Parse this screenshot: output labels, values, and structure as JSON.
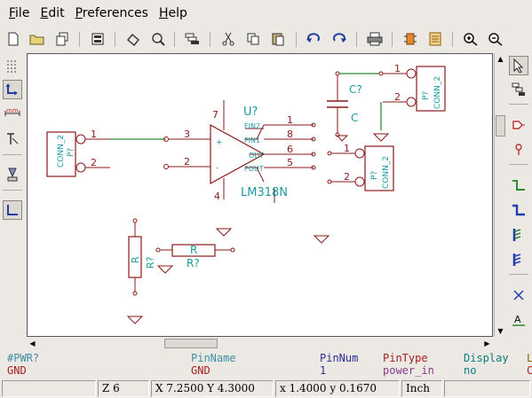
{
  "menu": {
    "file": {
      "mn": "F",
      "rest": "ile"
    },
    "edit": {
      "mn": "E",
      "rest": "dit"
    },
    "preferences": {
      "mn": "P",
      "rest": "references"
    },
    "help": {
      "mn": "H",
      "rest": "elp"
    }
  },
  "toolbar_icons": [
    "new-sheet-icon",
    "open-icon",
    "save-icon",
    "sheet-settings-icon",
    "undo-icon",
    "redo-icon",
    "component-list-icon",
    "cut-icon",
    "copy-icon",
    "paste-icon",
    "rotate-ccw-icon",
    "rotate-cw-icon",
    "print-icon",
    "annotate-icon",
    "bom-icon",
    "zoom-in-icon",
    "zoom-out-icon"
  ],
  "schematic": {
    "conn_left": {
      "ref": "P?",
      "value": "CONN_2",
      "pin1": "1",
      "pin2": "2"
    },
    "opamp": {
      "ref": "U?",
      "value": "LM318N",
      "pin_in_plus": "3",
      "pin_in_minus": "2",
      "pin_top": "7",
      "pin_bottom": "4",
      "plus_sign": "+",
      "minus_sign": "-",
      "fin2": "FIN2",
      "fin1": "FIN1",
      "out": "OUT",
      "fout": "FOUT",
      "pin_fin2": "1",
      "pin_fin1": "8",
      "pin_out": "6",
      "pin_fout": "5"
    },
    "cap": {
      "ref": "C?",
      "value": "C"
    },
    "conn_top_right": {
      "ref": "P?",
      "value": "CONN_2",
      "pin1": "1",
      "pin2": "2"
    },
    "conn_mid_right": {
      "ref": "P?",
      "value": "CONN_2",
      "pin1": "1",
      "pin2": "2"
    },
    "res_vert": {
      "ref": "R?",
      "value": "R"
    },
    "res_horiz": {
      "ref": "R?",
      "value": "R"
    }
  },
  "message_panel": {
    "col1_header": "#PWR?",
    "col1_value": "GND",
    "col2_header": "PinName",
    "col2_value": "GND",
    "col3_header": "PinNum",
    "col3_value": "1",
    "col4_header": "PinType",
    "col4_value": "power_in",
    "col5_header": "Display",
    "col5_value": "no",
    "col6_header": "L",
    "col6_value": "C"
  },
  "status": {
    "zoom": "Z 6",
    "cursor_abs": "X 7.2500  Y 4.3000",
    "cursor_rel": "x 1.4000  y 0.1670",
    "units": "Inch"
  },
  "colors": {
    "wire": "#2e8b2e",
    "component": "#8b1a1a",
    "field_ref": "#1a9aa0",
    "pin_num": "#8b1a1a"
  }
}
